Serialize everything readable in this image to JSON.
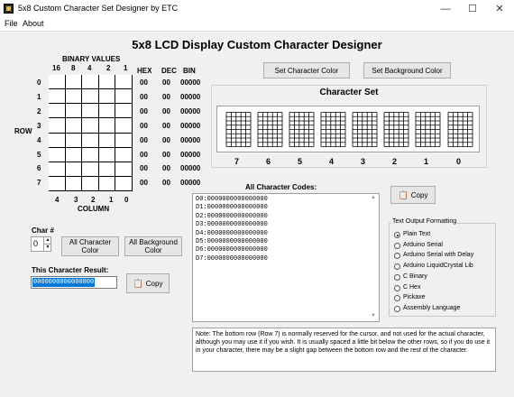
{
  "window": {
    "title": "5x8 Custom Character Set Designer by ETC",
    "minimize": "—",
    "maximize": "☐",
    "close": "✕"
  },
  "menu": [
    {
      "label": "File"
    },
    {
      "label": "About"
    }
  ],
  "app_title": "5x8 LCD Display Custom Character Designer",
  "binary_values_label": "BINARY VALUES",
  "bit_weights": [
    "16",
    "8",
    "4",
    "2",
    "1"
  ],
  "row_label": "ROW",
  "row_numbers": [
    "0",
    "1",
    "2",
    "3",
    "4",
    "5",
    "6",
    "7"
  ],
  "column_label": "COLUMN",
  "column_numbers": [
    "4",
    "3",
    "2",
    "1",
    "0"
  ],
  "value_headers": {
    "hex": "HEX",
    "dec": "DEC",
    "bin": "BIN"
  },
  "row_values": [
    {
      "hex": "00",
      "dec": "00",
      "bin": "00000"
    },
    {
      "hex": "00",
      "dec": "00",
      "bin": "00000"
    },
    {
      "hex": "00",
      "dec": "00",
      "bin": "00000"
    },
    {
      "hex": "00",
      "dec": "00",
      "bin": "00000"
    },
    {
      "hex": "00",
      "dec": "00",
      "bin": "00000"
    },
    {
      "hex": "00",
      "dec": "00",
      "bin": "00000"
    },
    {
      "hex": "00",
      "dec": "00",
      "bin": "00000"
    },
    {
      "hex": "00",
      "dec": "00",
      "bin": "00000"
    }
  ],
  "buttons": {
    "set_character_color": "Set Character Color",
    "set_background_color": "Set Background Color",
    "all_character_color": "All Character Color",
    "all_background_color_1": "All Background",
    "all_background_color_2": "Color",
    "copy_codes": "Copy",
    "copy_result": "Copy"
  },
  "character_set": {
    "title": "Character Set",
    "labels": [
      "7",
      "6",
      "5",
      "4",
      "3",
      "2",
      "1",
      "0"
    ]
  },
  "char_number": {
    "label": "Char #",
    "value": "0"
  },
  "result": {
    "label": "This Character Result:",
    "value": "0000000000000000"
  },
  "codes": {
    "label": "All Character Codes:",
    "lines": [
      "D0:0000000000000000",
      "D1:0000000000000000",
      "D2:0000000000000000",
      "D3:0000000000000000",
      "D4:0000000000000000",
      "D5:0000000000000000",
      "D6:0000000000000000",
      "D7:0000000000000000"
    ]
  },
  "output_formatting": {
    "title": "Text Output Formatting",
    "selected": 0,
    "options": [
      "Plain Text",
      "Arduino Serial",
      "Arduino Serial with Delay",
      "Arduino LiquidCrystal Lib",
      "C Binary",
      "C Hex",
      "Pickaxe",
      "Assembly Language"
    ]
  },
  "note": "Note: The bottom row (Row 7) is normally reserved for the cursor, and not used for the actual character, although you may use it if you wish. It is usually spaced a little bit below the other rows, so if you do use it in your character, there may be a slight gap between the bottom row and the rest of the character.",
  "colors": {
    "selection": "#0078d7",
    "pixel_on": "#000000",
    "pixel_off": "#ffffff"
  }
}
